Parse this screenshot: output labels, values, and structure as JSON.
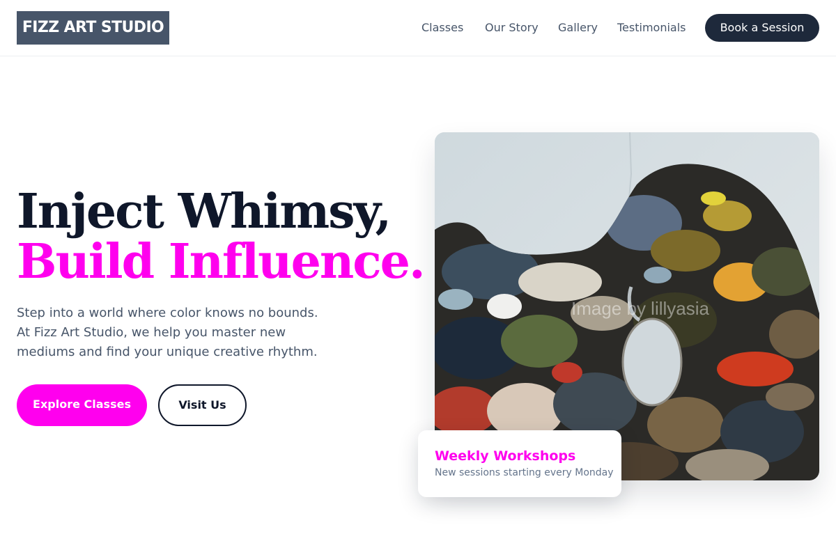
{
  "header": {
    "logo": "FIZZ ART STUDIO",
    "nav": [
      "Classes",
      "Our Story",
      "Gallery",
      "Testimonials"
    ],
    "cta": "Book a Session"
  },
  "hero": {
    "headline_line1": "Inject Whimsy,",
    "headline_line2": "Build Influence.",
    "description": "Step into a world where color knows no bounds. At Fizz Art Studio, we help you master new mediums and find your unique creative rhythm.",
    "primary_button": "Explore Classes",
    "secondary_button": "Visit Us",
    "image_watermark": "Image by lillyasia"
  },
  "card": {
    "title": "Weekly Workshops",
    "subtitle": "New sessions starting every Monday"
  },
  "colors": {
    "accent": "#ff00ee",
    "dark": "#0f172a",
    "logo_bg": "#475569",
    "cta_bg": "#1e293b",
    "muted_text": "#475569"
  },
  "icons": [
    "paint-palette-image"
  ]
}
